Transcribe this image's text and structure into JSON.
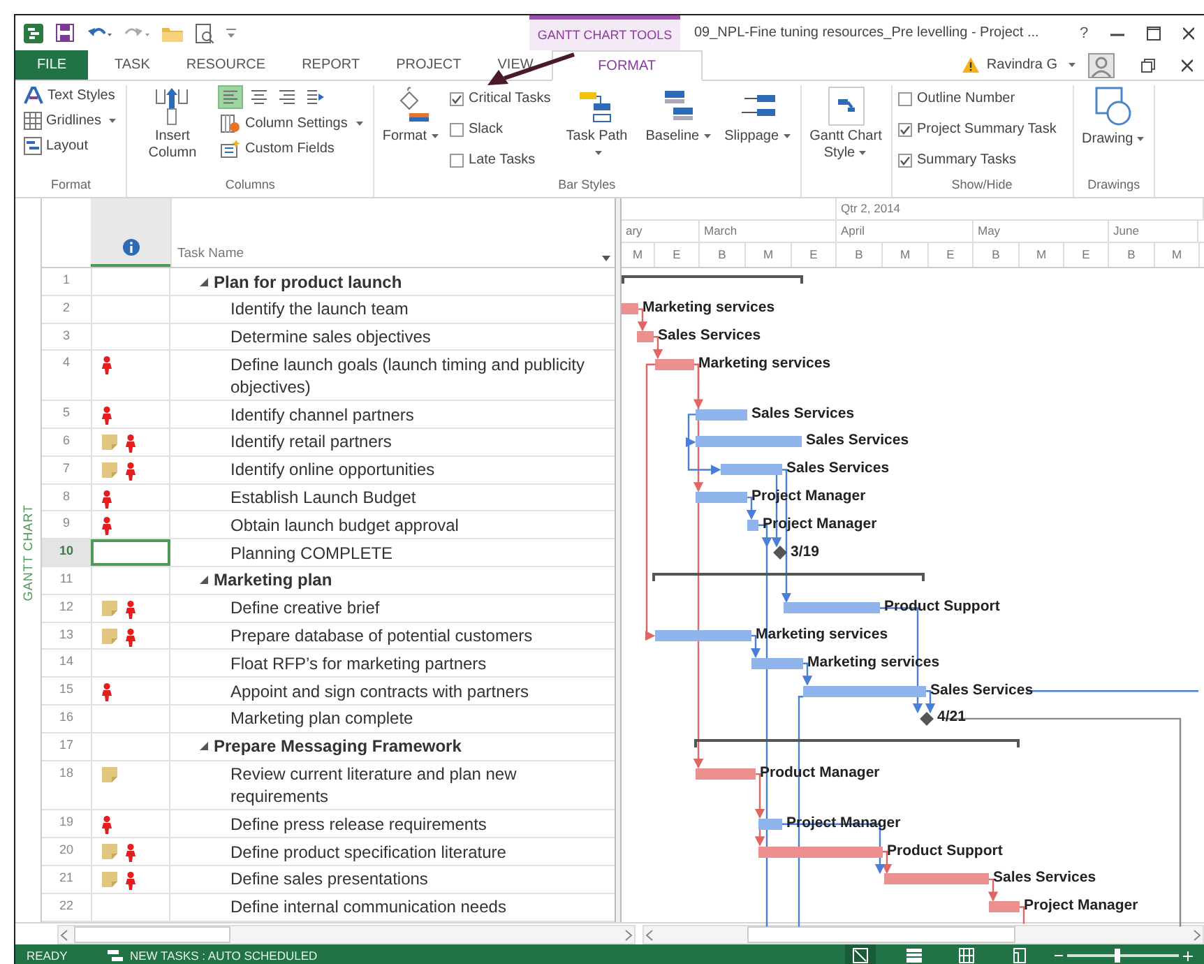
{
  "title_bar": {
    "contextual_tab": "GANTT CHART TOOLS",
    "title": "09_NPL-Fine tuning resources_Pre levelling - Project ...",
    "help": "?"
  },
  "tabs": [
    {
      "label": "FILE",
      "kind": "file",
      "selected": false
    },
    {
      "label": "TASK",
      "kind": "tab",
      "selected": false
    },
    {
      "label": "RESOURCE",
      "kind": "tab",
      "selected": false
    },
    {
      "label": "REPORT",
      "kind": "tab",
      "selected": false
    },
    {
      "label": "PROJECT",
      "kind": "tab",
      "selected": false
    },
    {
      "label": "VIEW",
      "kind": "tab",
      "selected": false
    },
    {
      "label": "FORMAT",
      "kind": "tab",
      "selected": true
    }
  ],
  "account": {
    "user": "Ravindra G"
  },
  "ribbon": {
    "groups": [
      {
        "label": "Format",
        "items": [
          {
            "kind": "small",
            "label": "Text Styles",
            "dropdown": false
          },
          {
            "kind": "small",
            "label": "Gridlines",
            "dropdown": true
          },
          {
            "kind": "small",
            "label": "Layout",
            "dropdown": false
          }
        ]
      },
      {
        "label": "Columns",
        "items": [
          {
            "kind": "large",
            "label": "Insert Column",
            "dropdown": false
          },
          {
            "kind": "align",
            "buttons": [
              {
                "selected": true
              },
              {
                "selected": false
              },
              {
                "selected": false
              },
              {
                "selected": false
              }
            ]
          },
          {
            "kind": "small",
            "label": "Column Settings",
            "dropdown": true
          },
          {
            "kind": "small",
            "label": "Custom Fields",
            "dropdown": false
          }
        ]
      },
      {
        "label": "Bar Styles",
        "items": [
          {
            "kind": "large",
            "label": "Format",
            "dropdown": true
          },
          {
            "kind": "check",
            "label": "Critical Tasks",
            "checked": true
          },
          {
            "kind": "check",
            "label": "Slack",
            "checked": false
          },
          {
            "kind": "check",
            "label": "Late Tasks",
            "checked": false
          },
          {
            "kind": "large",
            "label": "Task Path",
            "dropdown": true
          },
          {
            "kind": "large",
            "label": "Baseline",
            "dropdown": true
          },
          {
            "kind": "large",
            "label": "Slippage",
            "dropdown": true
          }
        ]
      },
      {
        "items": [
          {
            "kind": "large",
            "label": "Gantt Chart Style",
            "dropdown": true
          }
        ]
      },
      {
        "label": "Show/Hide",
        "items": [
          {
            "kind": "check",
            "label": "Outline Number",
            "checked": false
          },
          {
            "kind": "check",
            "label": "Project Summary Task",
            "checked": true
          },
          {
            "kind": "check",
            "label": "Summary Tasks",
            "checked": true
          }
        ]
      },
      {
        "label": "Drawings",
        "items": [
          {
            "kind": "large",
            "label": "Drawing",
            "dropdown": true
          }
        ]
      }
    ]
  },
  "view_label": "GANTT CHART",
  "table": {
    "name_column": "Task Name",
    "tasks": [
      {
        "id": "1",
        "name": "Plan for product launch",
        "expanded": true,
        "selected": false,
        "note": false,
        "overallocated": false,
        "bar": {
          "kind": "summary"
        },
        "children": [
          {
            "id": "2",
            "name": "Identify the launch team",
            "selected": false,
            "note": false,
            "overallocated": false,
            "bar": {
              "kind": "critical",
              "label": "Marketing services"
            }
          },
          {
            "id": "3",
            "name": "Determine sales objectives",
            "selected": false,
            "note": false,
            "overallocated": false,
            "bar": {
              "kind": "critical",
              "label": "Sales Services"
            }
          },
          {
            "id": "4",
            "name": "Define launch goals (launch timing and publicity objectives)",
            "selected": false,
            "note": false,
            "overallocated": true,
            "bar": {
              "kind": "critical",
              "label": "Marketing services"
            }
          },
          {
            "id": "5",
            "name": "Identify channel partners",
            "selected": false,
            "note": false,
            "overallocated": true,
            "bar": {
              "kind": "normal",
              "label": "Sales Services"
            }
          },
          {
            "id": "6",
            "name": "Identify retail partners",
            "selected": false,
            "note": true,
            "overallocated": true,
            "bar": {
              "kind": "normal",
              "label": "Sales Services"
            }
          },
          {
            "id": "7",
            "name": "Identify online opportunities",
            "selected": false,
            "note": true,
            "overallocated": true,
            "bar": {
              "kind": "normal",
              "label": "Sales Services"
            }
          },
          {
            "id": "8",
            "name": "Establish Launch Budget",
            "selected": false,
            "note": false,
            "overallocated": true,
            "bar": {
              "kind": "normal",
              "label": "Project Manager"
            }
          },
          {
            "id": "9",
            "name": "Obtain launch budget approval",
            "selected": false,
            "note": false,
            "overallocated": true,
            "bar": {
              "kind": "normal",
              "label": "Project Manager"
            }
          },
          {
            "id": "10",
            "name": "Planning COMPLETE",
            "selected": true,
            "note": false,
            "overallocated": false,
            "bar": {
              "kind": "milestone",
              "label": "3/19"
            }
          }
        ]
      },
      {
        "id": "11",
        "name": "Marketing plan",
        "expanded": true,
        "selected": false,
        "note": false,
        "overallocated": false,
        "bar": {
          "kind": "summary"
        },
        "children": [
          {
            "id": "12",
            "name": "Define creative brief",
            "selected": false,
            "note": true,
            "overallocated": true,
            "bar": {
              "kind": "normal",
              "label": "Product Support"
            }
          },
          {
            "id": "13",
            "name": "Prepare database of potential customers",
            "selected": false,
            "note": true,
            "overallocated": true,
            "bar": {
              "kind": "normal",
              "label": "Marketing services"
            }
          },
          {
            "id": "14",
            "name": "Float RFP’s for marketing partners",
            "selected": false,
            "note": false,
            "overallocated": false,
            "bar": {
              "kind": "normal",
              "label": "Marketing services"
            }
          },
          {
            "id": "15",
            "name": "Appoint and sign contracts with partners",
            "selected": false,
            "note": false,
            "overallocated": true,
            "bar": {
              "kind": "normal",
              "label": "Sales Services"
            }
          },
          {
            "id": "16",
            "name": "Marketing plan complete",
            "selected": false,
            "note": false,
            "overallocated": false,
            "bar": {
              "kind": "milestone",
              "label": "4/21"
            }
          }
        ]
      },
      {
        "id": "17",
        "name": "Prepare Messaging Framework",
        "expanded": true,
        "selected": false,
        "note": false,
        "overallocated": false,
        "bar": {
          "kind": "summary"
        },
        "children": [
          {
            "id": "18",
            "name": "Review current literature and plan new requirements",
            "selected": false,
            "note": true,
            "overallocated": false,
            "bar": {
              "kind": "critical",
              "label": "Product Manager"
            }
          },
          {
            "id": "19",
            "name": "Define press release requirements",
            "selected": false,
            "note": false,
            "overallocated": true,
            "bar": {
              "kind": "normal",
              "label": "Project Manager"
            }
          },
          {
            "id": "20",
            "name": "Define product specification literature",
            "selected": false,
            "note": true,
            "overallocated": true,
            "bar": {
              "kind": "critical",
              "label": "Product Support"
            }
          },
          {
            "id": "21",
            "name": "Define sales presentations",
            "selected": false,
            "note": true,
            "overallocated": true,
            "bar": {
              "kind": "critical",
              "label": "Sales Services"
            }
          },
          {
            "id": "22",
            "name": "Define internal communication needs",
            "selected": false,
            "note": false,
            "overallocated": false,
            "bar": {
              "kind": "critical",
              "label": "Project Manager"
            }
          }
        ]
      }
    ]
  },
  "timescale": {
    "top_tier": [
      "Qtr 2, 2014"
    ],
    "middle_tier": [
      "ary",
      "March",
      "April",
      "May",
      "June"
    ],
    "bottom_tier": [
      "M",
      "E",
      "B",
      "M",
      "E",
      "B",
      "M",
      "E",
      "B",
      "M",
      "E",
      "B",
      "M"
    ]
  },
  "status_bar": {
    "mode": "READY",
    "new_tasks": "NEW TASKS : AUTO SCHEDULED",
    "views": [
      {
        "selected": true
      },
      {
        "selected": false
      },
      {
        "selected": false
      },
      {
        "selected": false
      }
    ],
    "zoom": {
      "level": 0.45
    }
  }
}
